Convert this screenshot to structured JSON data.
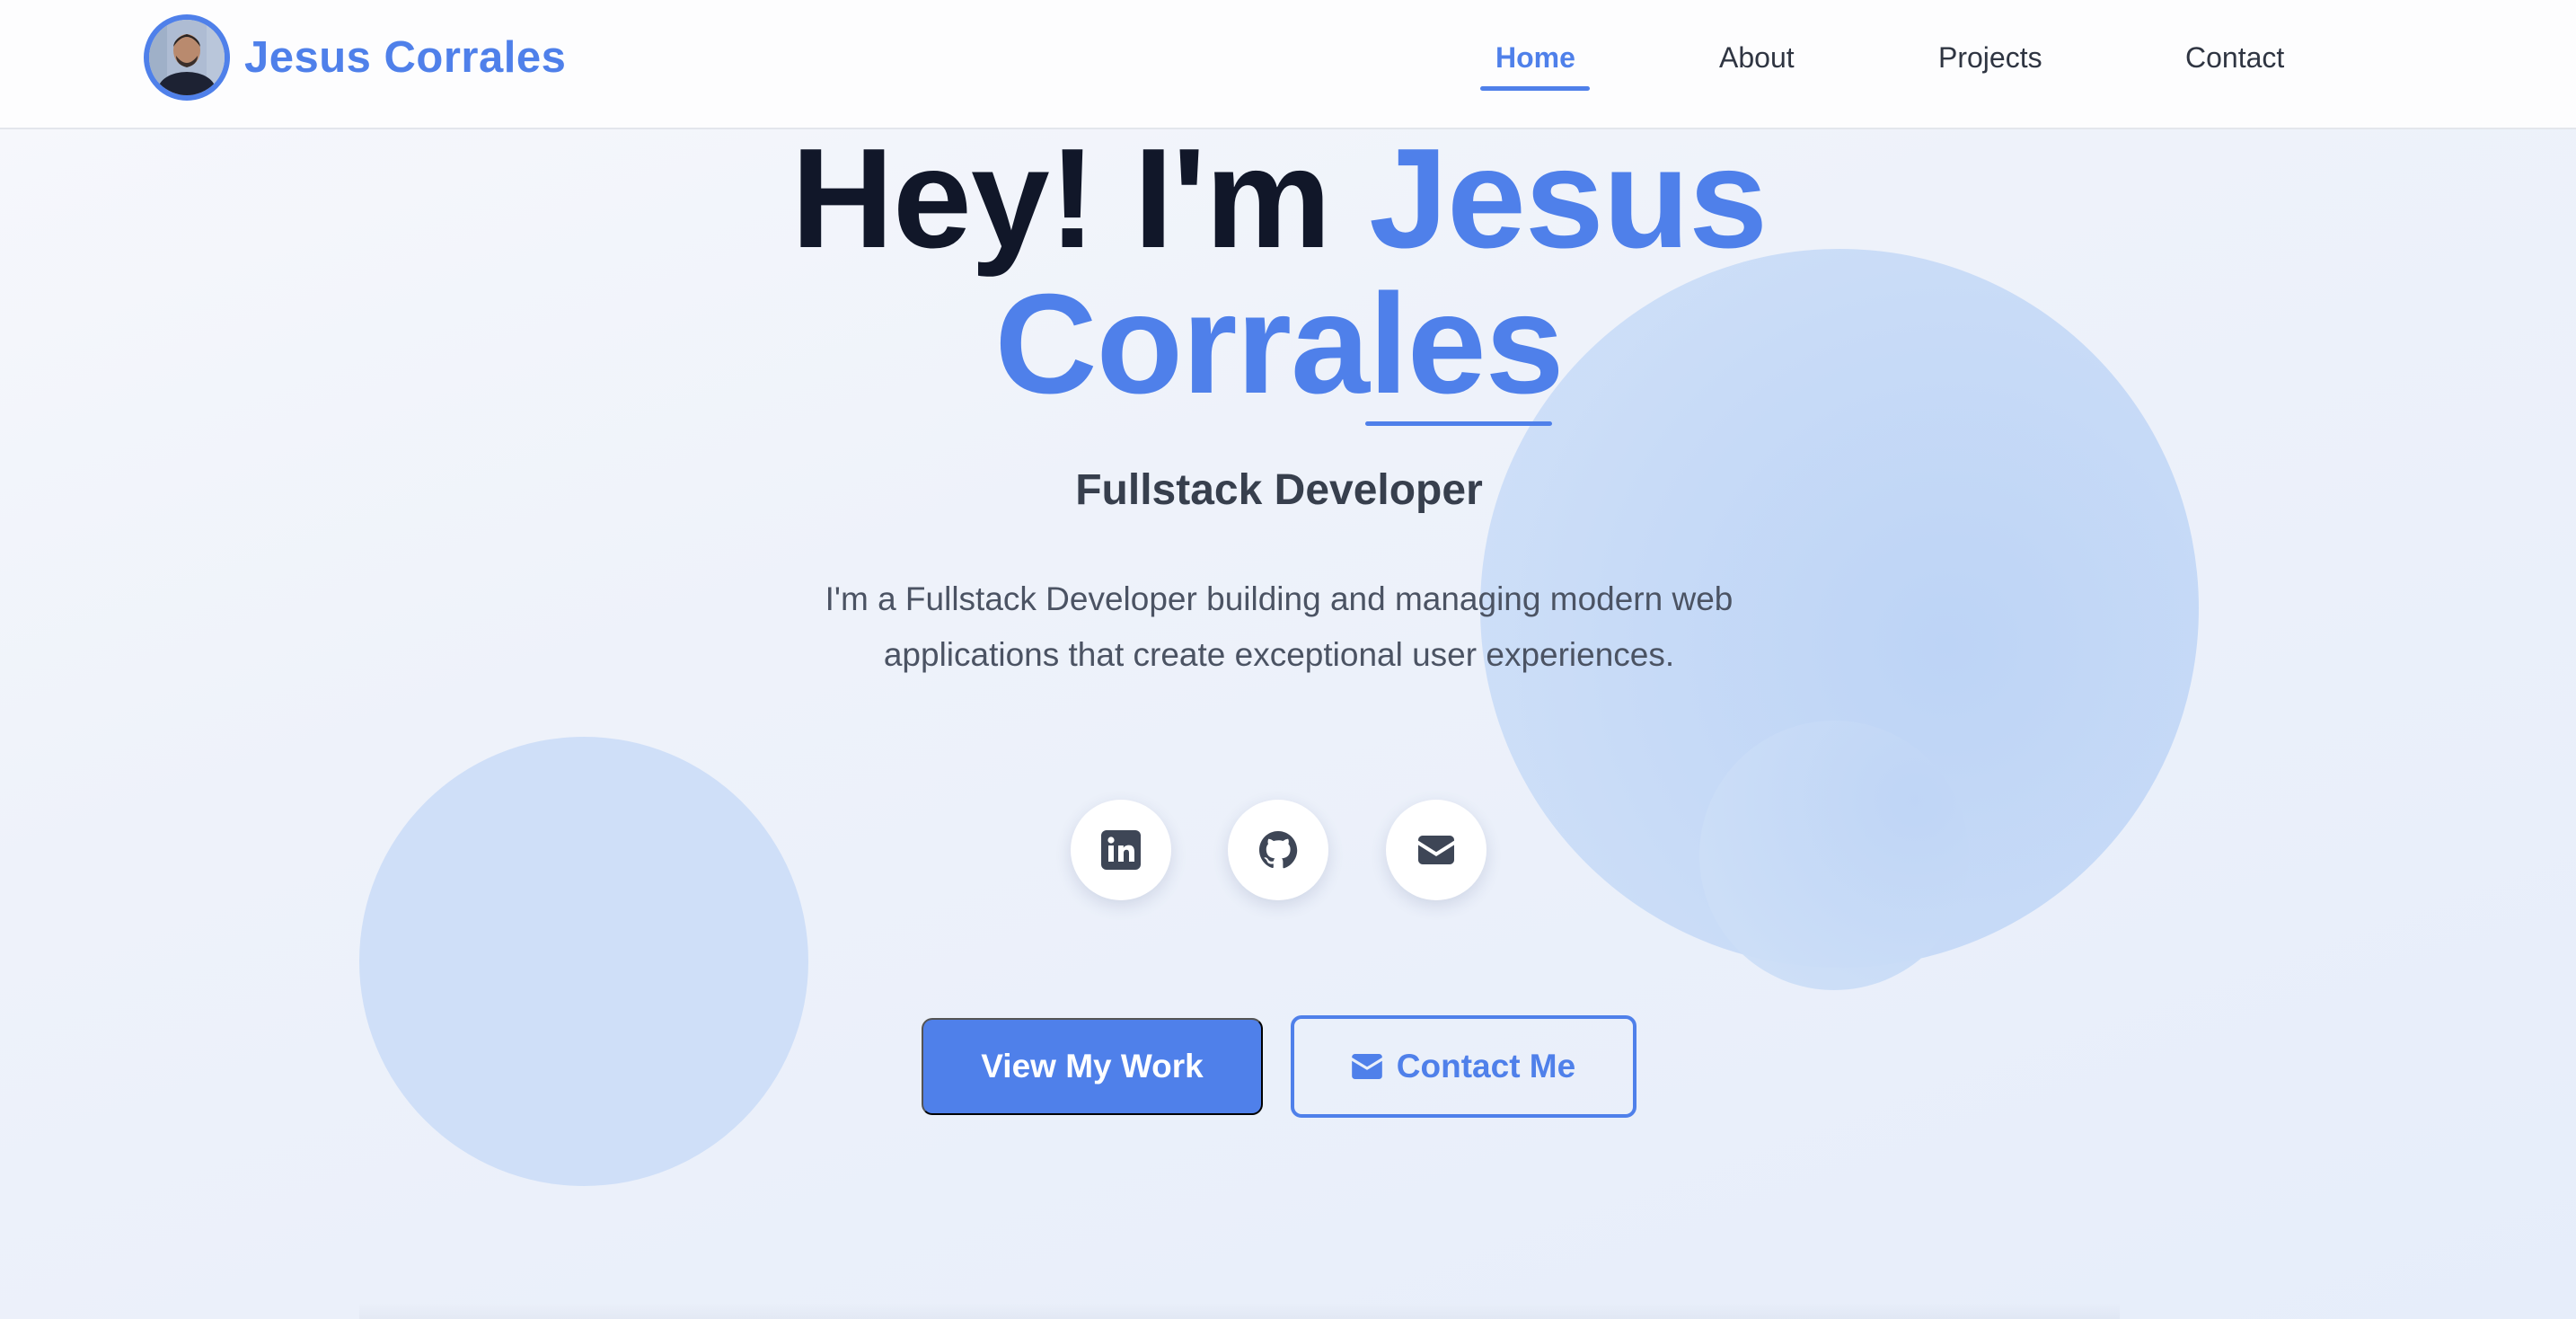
{
  "brand": {
    "name": "Jesus Corrales",
    "avatar": "profile-photo"
  },
  "nav": {
    "items": [
      {
        "label": "Home",
        "active": true
      },
      {
        "label": "About",
        "active": false
      },
      {
        "label": "Projects",
        "active": false
      },
      {
        "label": "Contact",
        "active": false
      }
    ]
  },
  "hero": {
    "greeting": "Hey! I'm",
    "name_first": "Jesus",
    "name_last": "Corrales",
    "subtitle": "Fullstack Developer",
    "description": "I'm a Fullstack Developer building and managing modern web applications that create exceptional user experiences."
  },
  "socials": [
    {
      "icon": "linkedin-icon"
    },
    {
      "icon": "github-icon"
    },
    {
      "icon": "envelope-icon"
    }
  ],
  "buttons": {
    "primary": "View My Work",
    "secondary": "Contact Me",
    "secondary_icon": "envelope-icon"
  },
  "colors": {
    "accent": "#4f80ea",
    "heading": "#111729",
    "text": "#4b5363",
    "background": "#eef2fa"
  }
}
